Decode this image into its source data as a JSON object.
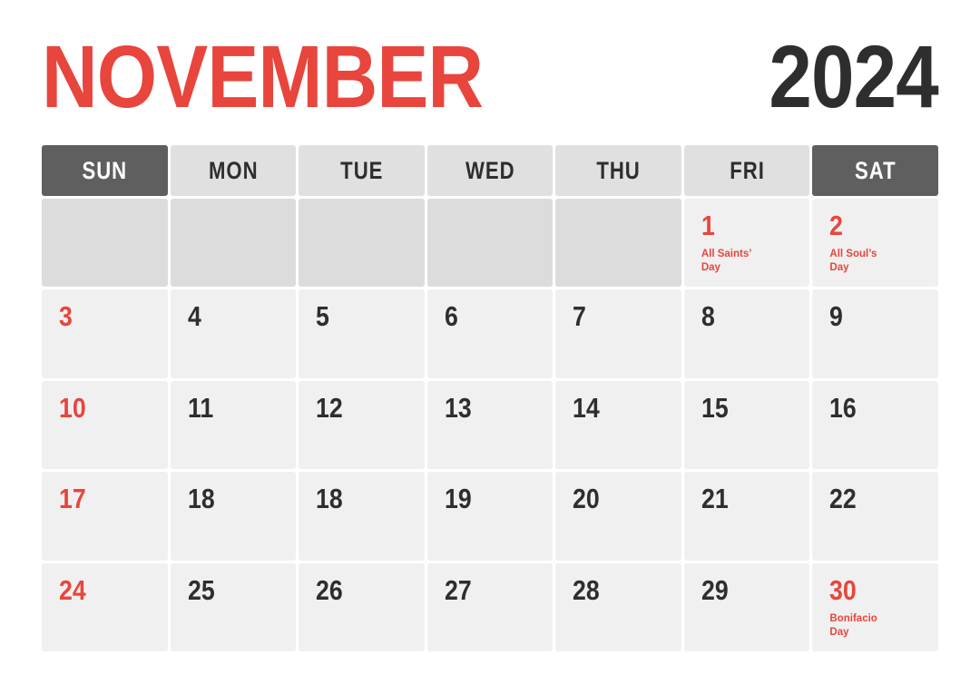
{
  "header": {
    "month": "NOVEMBER",
    "year": "2024"
  },
  "colors": {
    "accent_red": "#E8453C",
    "dark_charcoal": "#2E2E2E",
    "header_dark_gray": "#5F5F5F",
    "header_light_gray": "#E0E0E0",
    "date_cell_gray": "#F0F0F0",
    "blank_cell_gray": "#DCDCDC",
    "page_background": "#FFFFFF"
  },
  "daynames": [
    {
      "label": "SUN",
      "style": "weekend"
    },
    {
      "label": "MON",
      "style": "weekday"
    },
    {
      "label": "TUE",
      "style": "weekday"
    },
    {
      "label": "WED",
      "style": "weekday"
    },
    {
      "label": "THU",
      "style": "weekday"
    },
    {
      "label": "FRI",
      "style": "weekday"
    },
    {
      "label": "SAT",
      "style": "weekend"
    }
  ],
  "weeks": [
    [
      {
        "day": "",
        "holiday": "",
        "red": false,
        "blank": true
      },
      {
        "day": "",
        "holiday": "",
        "red": false,
        "blank": true
      },
      {
        "day": "",
        "holiday": "",
        "red": false,
        "blank": true
      },
      {
        "day": "",
        "holiday": "",
        "red": false,
        "blank": true
      },
      {
        "day": "",
        "holiday": "",
        "red": false,
        "blank": true
      },
      {
        "day": "1",
        "holiday": "All Saints’\nDay",
        "red": true,
        "blank": false
      },
      {
        "day": "2",
        "holiday": "All Soul’s\nDay",
        "red": true,
        "blank": false
      }
    ],
    [
      {
        "day": "3",
        "holiday": "",
        "red": true,
        "blank": false
      },
      {
        "day": "4",
        "holiday": "",
        "red": false,
        "blank": false
      },
      {
        "day": "5",
        "holiday": "",
        "red": false,
        "blank": false
      },
      {
        "day": "6",
        "holiday": "",
        "red": false,
        "blank": false
      },
      {
        "day": "7",
        "holiday": "",
        "red": false,
        "blank": false
      },
      {
        "day": "8",
        "holiday": "",
        "red": false,
        "blank": false
      },
      {
        "day": "9",
        "holiday": "",
        "red": false,
        "blank": false
      }
    ],
    [
      {
        "day": "10",
        "holiday": "",
        "red": true,
        "blank": false
      },
      {
        "day": "11",
        "holiday": "",
        "red": false,
        "blank": false
      },
      {
        "day": "12",
        "holiday": "",
        "red": false,
        "blank": false
      },
      {
        "day": "13",
        "holiday": "",
        "red": false,
        "blank": false
      },
      {
        "day": "14",
        "holiday": "",
        "red": false,
        "blank": false
      },
      {
        "day": "15",
        "holiday": "",
        "red": false,
        "blank": false
      },
      {
        "day": "16",
        "holiday": "",
        "red": false,
        "blank": false
      }
    ],
    [
      {
        "day": "17",
        "holiday": "",
        "red": true,
        "blank": false
      },
      {
        "day": "18",
        "holiday": "",
        "red": false,
        "blank": false
      },
      {
        "day": "18",
        "holiday": "",
        "red": false,
        "blank": false
      },
      {
        "day": "19",
        "holiday": "",
        "red": false,
        "blank": false
      },
      {
        "day": "20",
        "holiday": "",
        "red": false,
        "blank": false
      },
      {
        "day": "21",
        "holiday": "",
        "red": false,
        "blank": false
      },
      {
        "day": "22",
        "holiday": "",
        "red": false,
        "blank": false
      }
    ],
    [
      {
        "day": "24",
        "holiday": "",
        "red": true,
        "blank": false
      },
      {
        "day": "25",
        "holiday": "",
        "red": false,
        "blank": false
      },
      {
        "day": "26",
        "holiday": "",
        "red": false,
        "blank": false
      },
      {
        "day": "27",
        "holiday": "",
        "red": false,
        "blank": false
      },
      {
        "day": "28",
        "holiday": "",
        "red": false,
        "blank": false
      },
      {
        "day": "29",
        "holiday": "",
        "red": false,
        "blank": false
      },
      {
        "day": "30",
        "holiday": "Bonifacio\nDay",
        "red": true,
        "blank": false
      }
    ]
  ]
}
